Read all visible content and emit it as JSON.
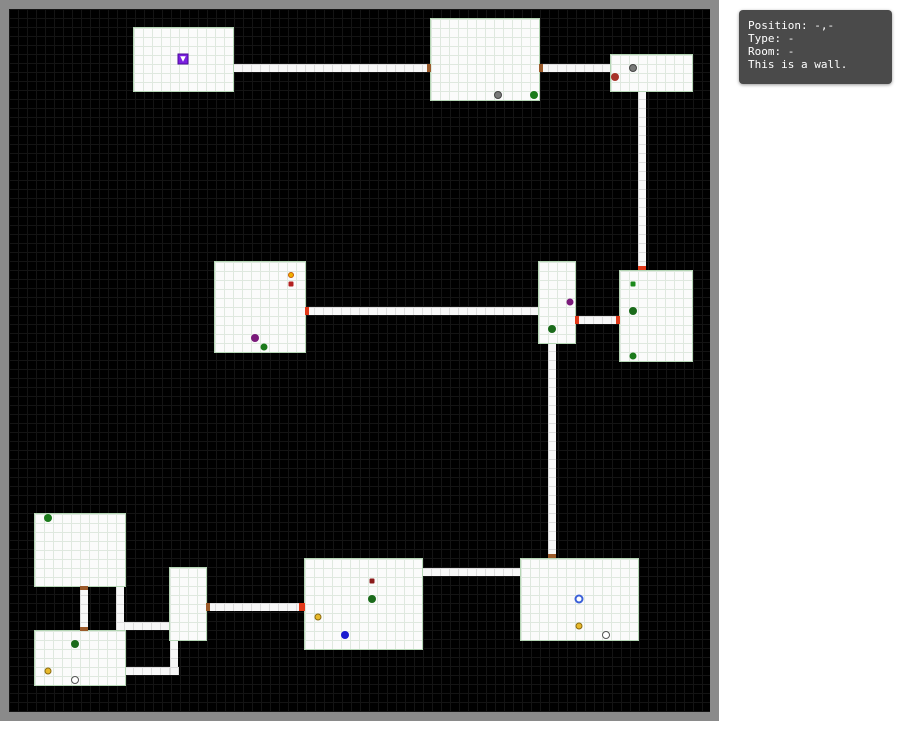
{
  "info_panel": {
    "position_label": "Position:",
    "position_value": "-,-",
    "type_label": "Type:",
    "type_value": "-",
    "room_label": "Room:",
    "room_value": "-",
    "description": "This is a wall."
  },
  "colors": {
    "border": "#8a8a8a",
    "wall": "#000000",
    "floor": "#fbfbfb",
    "door": "#9b5a2a",
    "locked_door": "#e23a1a",
    "player": "#7b1fe0",
    "panel_bg": "#4a4a4a",
    "panel_text": "#ffffff"
  },
  "entity_types": {
    "player": "player-icon",
    "green_orb": "green-orb-icon",
    "gray_orb": "gray-orb-icon",
    "red_orb": "red-orb-icon",
    "purple_orb": "purple-orb-icon",
    "blue_orb": "blue-orb-icon",
    "gold_coin": "gold-coin-icon",
    "white_ring": "white-ring-icon",
    "blue_potion": "blue-potion-icon",
    "red_key": "red-key-icon",
    "green_key": "green-key-icon",
    "gold_gem": "gold-gem-icon"
  }
}
